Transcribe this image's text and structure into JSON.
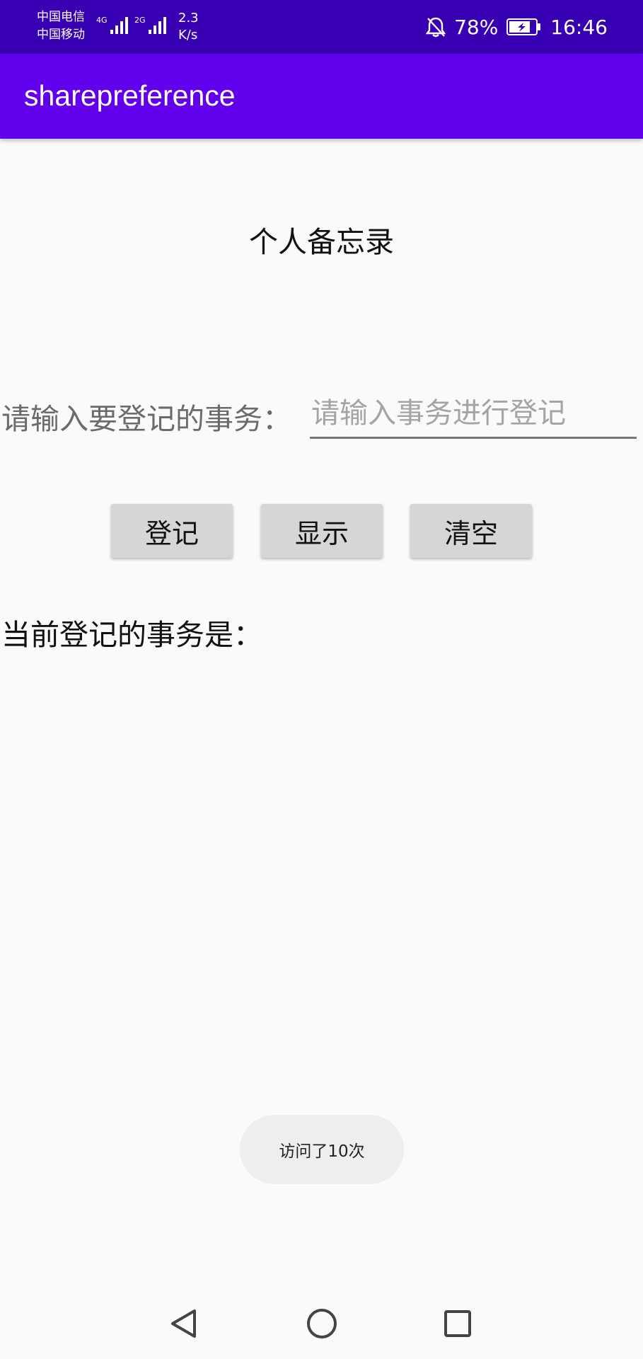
{
  "status_bar": {
    "carrier_1": "中国电信",
    "carrier_2": "中国移动",
    "network_1": "4G",
    "network_2": "2G",
    "speed_value": "2.3",
    "speed_unit": "K/s",
    "battery": "78%",
    "time": "16:46",
    "icons": [
      "signal-icon",
      "mute-bell-icon",
      "battery-icon"
    ]
  },
  "app_bar": {
    "title": "sharepreference"
  },
  "main": {
    "heading": "个人备忘录",
    "input_label": "请输入要登记的事务：",
    "input_value": "",
    "input_placeholder": "请输入事务进行登记",
    "buttons": {
      "register": "登记",
      "show": "显示",
      "clear": "清空"
    },
    "current_label": "当前登记的事务是：",
    "current_value": ""
  },
  "toast": {
    "text": "访问了10次"
  },
  "nav_bar": {
    "icons": [
      "back-icon",
      "home-icon",
      "recents-icon"
    ]
  },
  "colors": {
    "status_bar": "#3700b3",
    "app_bar": "#6200ee",
    "button": "#d6d6d6",
    "background": "#fafafa"
  }
}
